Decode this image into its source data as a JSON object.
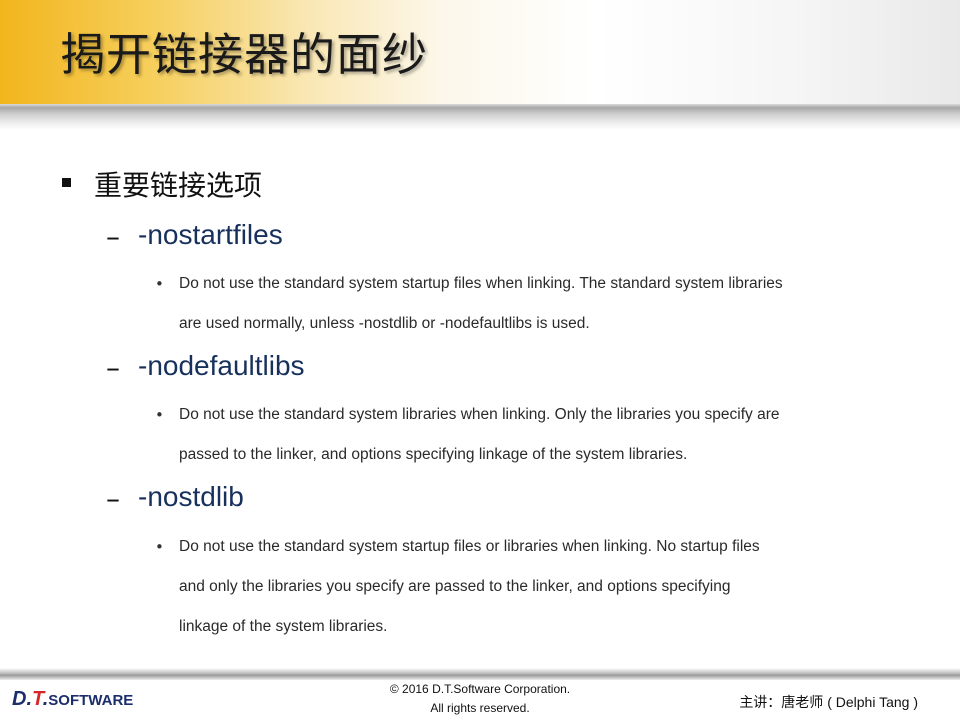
{
  "title": "揭开链接器的面纱",
  "bullet": "重要链接选项",
  "options": [
    {
      "name": "-nostartfiles",
      "lines": [
        "Do not use the standard system startup files when linking. The standard system libraries",
        "are used normally, unless -nostdlib or -nodefaultlibs is used."
      ]
    },
    {
      "name": "-nodefaultlibs",
      "lines": [
        "Do not use the standard system libraries when linking. Only the libraries you specify are",
        "passed to the linker, and options specifying linkage of the system libraries."
      ]
    },
    {
      "name": "-nostdlib",
      "lines": [
        "Do not use the standard system startup files or libraries when linking. No startup files",
        "and only the libraries you specify are passed to the linker, and options specifying",
        "linkage of the system libraries."
      ]
    }
  ],
  "footer": {
    "logo_dt_d": "D.",
    "logo_dt_t": "T",
    "logo_dt_dot": ".",
    "logo_software": "SOFTWARE",
    "copyright_line1": "© 2016 D.T.Software Corporation.",
    "copyright_line2": "All rights reserved.",
    "lecturer": "主讲：唐老师 ( Delphi Tang )"
  },
  "colors": {
    "title_gradient_start": "#f2b51d",
    "option_color": "#17305c",
    "logo_blue": "#1b2e6b",
    "logo_red": "#d6262a"
  }
}
